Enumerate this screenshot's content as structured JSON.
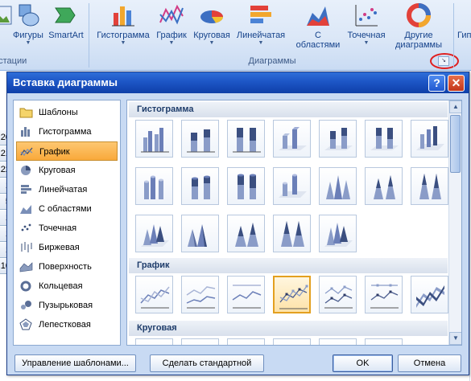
{
  "ribbon": {
    "illustrations_tools": [
      {
        "label": "",
        "icon": "picture-icon"
      },
      {
        "label": "Фигуры",
        "icon": "shapes-icon"
      },
      {
        "label": "SmartArt",
        "icon": "smartart-icon"
      }
    ],
    "illustrations_group_label": "остации",
    "chart_buttons": [
      {
        "label": "Гистограмма",
        "icon": "column-chart-icon"
      },
      {
        "label": "График",
        "icon": "line-chart-icon"
      },
      {
        "label": "Круговая",
        "icon": "pie-chart-icon"
      },
      {
        "label": "Линейчатая",
        "icon": "bar-chart-icon"
      },
      {
        "label": "С областями",
        "line1": "С",
        "line2": "областями",
        "icon": "area-chart-icon"
      },
      {
        "label": "Точечная",
        "icon": "scatter-chart-icon"
      },
      {
        "label": "Другие диаграммы",
        "line1": "Другие",
        "line2": "диаграммы",
        "icon": "other-charts-icon"
      }
    ],
    "charts_group_label": "Диаграммы",
    "right_cut_label": "Гип"
  },
  "sheet": {
    "row_numbers": [
      "20",
      "21",
      "22",
      "1",
      "5",
      "1",
      "1",
      "1",
      "10"
    ]
  },
  "dialog": {
    "title": "Вставка диаграммы",
    "help_label": "?",
    "close_label": "✕",
    "chart_types": [
      {
        "label": "Шаблоны",
        "icon": "folder-icon"
      },
      {
        "label": "Гистограмма",
        "icon": "column-chart-icon"
      },
      {
        "label": "График",
        "icon": "line-chart-icon",
        "selected": true
      },
      {
        "label": "Круговая",
        "icon": "pie-chart-icon"
      },
      {
        "label": "Линейчатая",
        "icon": "bar-chart-icon"
      },
      {
        "label": "С областями",
        "icon": "area-chart-icon"
      },
      {
        "label": "Точечная",
        "icon": "scatter-chart-icon"
      },
      {
        "label": "Биржевая",
        "icon": "stock-chart-icon"
      },
      {
        "label": "Поверхность",
        "icon": "surface-chart-icon"
      },
      {
        "label": "Кольцевая",
        "icon": "doughnut-chart-icon"
      },
      {
        "label": "Пузырьковая",
        "icon": "bubble-chart-icon"
      },
      {
        "label": "Лепестковая",
        "icon": "radar-chart-icon"
      }
    ],
    "sections": [
      {
        "label": "Гистограмма"
      },
      {
        "label": "График"
      },
      {
        "label": "Круговая"
      }
    ],
    "buttons": {
      "manage_templates": "Управление шаблонами...",
      "set_default": "Сделать стандартной",
      "ok": "OK",
      "cancel": "Отмена"
    }
  },
  "colors": {
    "selection": "#f9a93a",
    "title_bar": "#1d56c6",
    "close_button": "#c3361a"
  }
}
